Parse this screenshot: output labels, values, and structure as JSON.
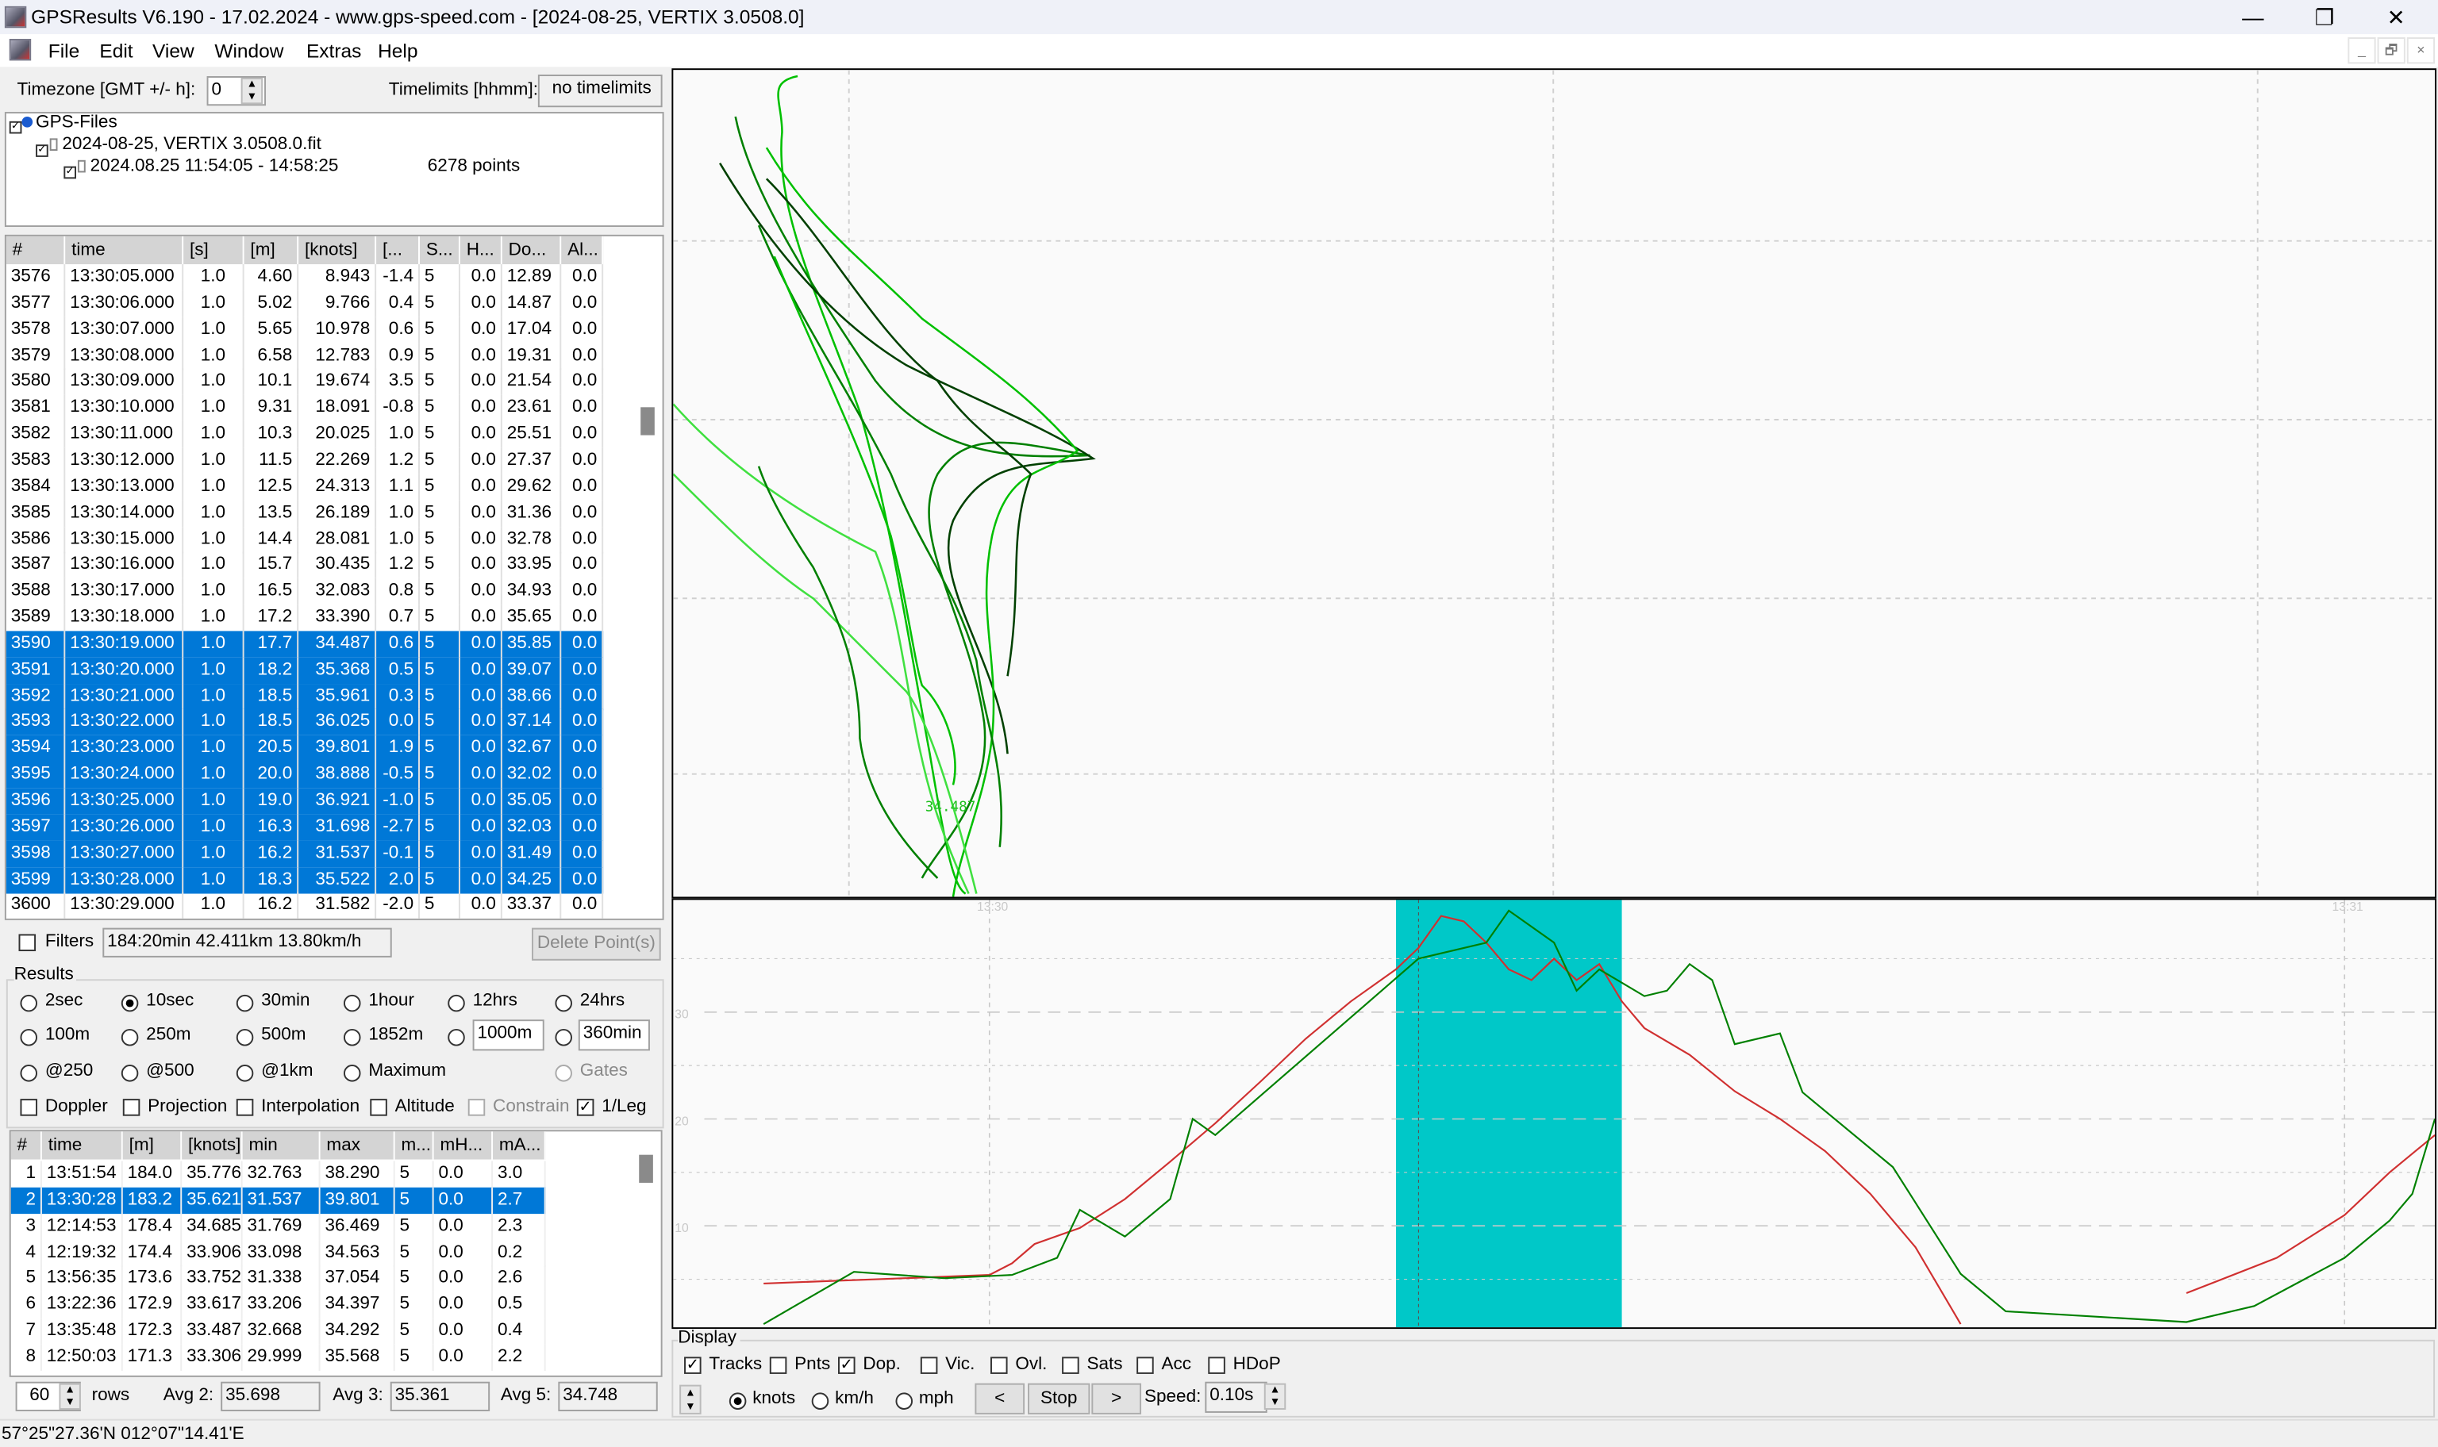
{
  "window": {
    "title": "GPSResults V6.190 - 17.02.2024 - www.gps-speed.com - [2024-08-25, VERTIX 3.0508.0]",
    "minimize": "—",
    "restore": "❐",
    "close": "✕"
  },
  "menu": [
    {
      "label": "File"
    },
    {
      "label": "Edit"
    },
    {
      "label": "View"
    },
    {
      "label": "Window"
    },
    {
      "label": "Extras"
    },
    {
      "label": "Help"
    }
  ],
  "mdi": {
    "min": "_",
    "restore": "🗗",
    "close": "×"
  },
  "timezone": {
    "label": "Timezone [GMT +/- h]:",
    "value": "0"
  },
  "timelimits": {
    "label": "Timelimits [hhmm]:",
    "value": "no timelimits"
  },
  "tree": {
    "root": "GPS-Files",
    "file": "2024-08-25, VERTIX 3.0508.0.fit",
    "track": "2024.08.25 11:54:05 - 14:58:25",
    "points": "6278 points"
  },
  "points_table": {
    "columns": [
      "#",
      "time",
      "[s]",
      "[m]",
      "[knots]",
      "[...",
      "S...",
      "H...",
      "Do...",
      "Al..."
    ],
    "rows": [
      [
        "3576",
        "13:30:05.000",
        "1.0",
        "4.60",
        "8.943",
        "-1.4",
        "5",
        "0.0",
        "12.89",
        "0.0"
      ],
      [
        "3577",
        "13:30:06.000",
        "1.0",
        "5.02",
        "9.766",
        "0.4",
        "5",
        "0.0",
        "14.87",
        "0.0"
      ],
      [
        "3578",
        "13:30:07.000",
        "1.0",
        "5.65",
        "10.978",
        "0.6",
        "5",
        "0.0",
        "17.04",
        "0.0"
      ],
      [
        "3579",
        "13:30:08.000",
        "1.0",
        "6.58",
        "12.783",
        "0.9",
        "5",
        "0.0",
        "19.31",
        "0.0"
      ],
      [
        "3580",
        "13:30:09.000",
        "1.0",
        "10.1",
        "19.674",
        "3.5",
        "5",
        "0.0",
        "21.54",
        "0.0"
      ],
      [
        "3581",
        "13:30:10.000",
        "1.0",
        "9.31",
        "18.091",
        "-0.8",
        "5",
        "0.0",
        "23.61",
        "0.0"
      ],
      [
        "3582",
        "13:30:11.000",
        "1.0",
        "10.3",
        "20.025",
        "1.0",
        "5",
        "0.0",
        "25.51",
        "0.0"
      ],
      [
        "3583",
        "13:30:12.000",
        "1.0",
        "11.5",
        "22.269",
        "1.2",
        "5",
        "0.0",
        "27.37",
        "0.0"
      ],
      [
        "3584",
        "13:30:13.000",
        "1.0",
        "12.5",
        "24.313",
        "1.1",
        "5",
        "0.0",
        "29.62",
        "0.0"
      ],
      [
        "3585",
        "13:30:14.000",
        "1.0",
        "13.5",
        "26.189",
        "1.0",
        "5",
        "0.0",
        "31.36",
        "0.0"
      ],
      [
        "3586",
        "13:30:15.000",
        "1.0",
        "14.4",
        "28.081",
        "1.0",
        "5",
        "0.0",
        "32.78",
        "0.0"
      ],
      [
        "3587",
        "13:30:16.000",
        "1.0",
        "15.7",
        "30.435",
        "1.2",
        "5",
        "0.0",
        "33.95",
        "0.0"
      ],
      [
        "3588",
        "13:30:17.000",
        "1.0",
        "16.5",
        "32.083",
        "0.8",
        "5",
        "0.0",
        "34.93",
        "0.0"
      ],
      [
        "3589",
        "13:30:18.000",
        "1.0",
        "17.2",
        "33.390",
        "0.7",
        "5",
        "0.0",
        "35.65",
        "0.0"
      ],
      [
        "3590",
        "13:30:19.000",
        "1.0",
        "17.7",
        "34.487",
        "0.6",
        "5",
        "0.0",
        "35.85",
        "0.0"
      ],
      [
        "3591",
        "13:30:20.000",
        "1.0",
        "18.2",
        "35.368",
        "0.5",
        "5",
        "0.0",
        "39.07",
        "0.0"
      ],
      [
        "3592",
        "13:30:21.000",
        "1.0",
        "18.5",
        "35.961",
        "0.3",
        "5",
        "0.0",
        "38.66",
        "0.0"
      ],
      [
        "3593",
        "13:30:22.000",
        "1.0",
        "18.5",
        "36.025",
        "0.0",
        "5",
        "0.0",
        "37.14",
        "0.0"
      ],
      [
        "3594",
        "13:30:23.000",
        "1.0",
        "20.5",
        "39.801",
        "1.9",
        "5",
        "0.0",
        "32.67",
        "0.0"
      ],
      [
        "3595",
        "13:30:24.000",
        "1.0",
        "20.0",
        "38.888",
        "-0.5",
        "5",
        "0.0",
        "32.02",
        "0.0"
      ],
      [
        "3596",
        "13:30:25.000",
        "1.0",
        "19.0",
        "36.921",
        "-1.0",
        "5",
        "0.0",
        "35.05",
        "0.0"
      ],
      [
        "3597",
        "13:30:26.000",
        "1.0",
        "16.3",
        "31.698",
        "-2.7",
        "5",
        "0.0",
        "32.03",
        "0.0"
      ],
      [
        "3598",
        "13:30:27.000",
        "1.0",
        "16.2",
        "31.537",
        "-0.1",
        "5",
        "0.0",
        "31.49",
        "0.0"
      ],
      [
        "3599",
        "13:30:28.000",
        "1.0",
        "18.3",
        "35.522",
        "2.0",
        "5",
        "0.0",
        "34.25",
        "0.0"
      ],
      [
        "3600",
        "13:30:29.000",
        "1.0",
        "16.2",
        "31.582",
        "-2.0",
        "5",
        "0.0",
        "33.37",
        "0.0"
      ]
    ],
    "selected_from": "3590",
    "selected_to": "3599"
  },
  "filters": {
    "label": "Filters",
    "checked": false,
    "summary": "184:20min 42.411km 13.80km/h",
    "delete": "Delete Point(s)"
  },
  "results": {
    "label": "Results",
    "radios": [
      [
        "2sec",
        "10sec",
        "30min",
        "1hour",
        "12hrs",
        "24hrs"
      ],
      [
        "100m",
        "250m",
        "500m",
        "1852m",
        "",
        ""
      ],
      [
        "@250",
        "@500",
        "@1km",
        "Maximum",
        "",
        "Gates"
      ]
    ],
    "selected": "10sec",
    "custom_distance": "1000m",
    "custom_time": "360min",
    "checks": [
      {
        "label": "Doppler",
        "checked": false
      },
      {
        "label": "Projection",
        "checked": false
      },
      {
        "label": "Interpolation",
        "checked": false
      },
      {
        "label": "Altitude",
        "checked": false
      },
      {
        "label": "Constrain",
        "checked": false,
        "disabled": true
      },
      {
        "label": "1/Leg",
        "checked": true
      }
    ]
  },
  "results_table": {
    "columns": [
      "#",
      "time",
      "[m]",
      "[knots]",
      "min",
      "max",
      "m...",
      "mH...",
      "mA..."
    ],
    "rows": [
      [
        "1",
        "13:51:54",
        "184.0",
        "35.776",
        "32.763",
        "38.290",
        "5",
        "0.0",
        "3.0"
      ],
      [
        "2",
        "13:30:28",
        "183.2",
        "35.621",
        "31.537",
        "39.801",
        "5",
        "0.0",
        "2.7"
      ],
      [
        "3",
        "12:14:53",
        "178.4",
        "34.685",
        "31.769",
        "36.469",
        "5",
        "0.0",
        "2.3"
      ],
      [
        "4",
        "12:19:32",
        "174.4",
        "33.906",
        "33.098",
        "34.563",
        "5",
        "0.0",
        "0.2"
      ],
      [
        "5",
        "13:56:35",
        "173.6",
        "33.752",
        "31.338",
        "37.054",
        "5",
        "0.0",
        "2.6"
      ],
      [
        "6",
        "13:22:36",
        "172.9",
        "33.617",
        "33.206",
        "34.397",
        "5",
        "0.0",
        "0.5"
      ],
      [
        "7",
        "13:35:48",
        "172.3",
        "33.487",
        "32.668",
        "34.292",
        "5",
        "0.0",
        "0.4"
      ],
      [
        "8",
        "12:50:03",
        "171.3",
        "33.306",
        "29.999",
        "35.568",
        "5",
        "0.0",
        "2.2"
      ]
    ],
    "selected_row": "2"
  },
  "footer": {
    "rows_value": "60",
    "rows_label": "rows",
    "avg2_label": "Avg 2:",
    "avg2": "35.698",
    "avg3_label": "Avg 3:",
    "avg3": "35.361",
    "avg5_label": "Avg 5:",
    "avg5": "34.748"
  },
  "status": {
    "coords": "57°25\"27.36'N 012°07\"14.41'E"
  },
  "map": {
    "label": "34.487",
    "track_colors": [
      "#00c000",
      "#008000",
      "#004000",
      "#40e040"
    ]
  },
  "display": {
    "label": "Display",
    "checks": [
      {
        "label": "Tracks",
        "checked": true
      },
      {
        "label": "Pnts",
        "checked": false
      },
      {
        "label": "Dop.",
        "checked": true
      },
      {
        "label": "Vic.",
        "checked": false
      },
      {
        "label": "Ovl.",
        "checked": false
      },
      {
        "label": "Sats",
        "checked": false
      },
      {
        "label": "Acc",
        "checked": false
      },
      {
        "label": "HDoP",
        "checked": false
      }
    ],
    "units": [
      "knots",
      "km/h",
      "mph"
    ],
    "unit_selected": "knots",
    "prev": "<",
    "stop": "Stop",
    "next": ">",
    "speed_label": "Speed:",
    "speed": "0.10s"
  },
  "chart_data": {
    "type": "line",
    "xlim": [
      "13:29:46",
      "13:31:04"
    ],
    "ylim": [
      0.5,
      40.5
    ],
    "x_ticks": [
      "13:30",
      "13:31"
    ],
    "y_ticks": [
      10,
      20,
      30
    ],
    "grid": true,
    "highlight": [
      "13:30:18",
      "13:30:28"
    ],
    "cursor": "13:30:19",
    "colors": {
      "highlight": "#00c8c8",
      "grid": "#c8c8c8",
      "tick": "#c8c8c8"
    },
    "series": [
      {
        "color": "#d03030",
        "points": [
          [
            "13:29:50",
            4.6
          ],
          [
            "13:29:55",
            5.0
          ],
          [
            "13:30:00",
            5.4
          ],
          [
            "13:30:01",
            6.5
          ],
          [
            "13:30:02",
            8.3
          ],
          [
            "13:30:04",
            9.8
          ],
          [
            "13:30:06",
            12.5
          ],
          [
            "13:30:08",
            16
          ],
          [
            "13:30:10",
            19.6
          ],
          [
            "13:30:12",
            23.5
          ],
          [
            "13:30:14",
            27.5
          ],
          [
            "13:30:16",
            31
          ],
          [
            "13:30:18",
            34
          ],
          [
            "13:30:19",
            36
          ],
          [
            "13:30:20",
            39
          ],
          [
            "13:30:21",
            38.5
          ],
          [
            "13:30:22",
            36.5
          ],
          [
            "13:30:23",
            34
          ],
          [
            "13:30:24",
            33
          ],
          [
            "13:30:25",
            35
          ],
          [
            "13:30:26",
            33
          ],
          [
            "13:30:27",
            34.5
          ],
          [
            "13:30:28",
            31
          ],
          [
            "13:30:29",
            28.5
          ],
          [
            "13:30:31",
            26
          ],
          [
            "13:30:33",
            22.6
          ],
          [
            "13:30:35",
            20
          ],
          [
            "13:30:37",
            17
          ],
          [
            "13:30:39",
            13
          ],
          [
            "13:30:41",
            8
          ],
          [
            "13:30:43",
            0.8
          ],
          null,
          [
            "13:30:53",
            3.7
          ],
          [
            "13:30:57",
            7
          ],
          [
            "13:31:00",
            11
          ],
          [
            "13:31:02",
            15
          ],
          [
            "13:31:04",
            18.5
          ]
        ]
      },
      {
        "color": "#008000",
        "points": [
          [
            "13:29:50",
            0.8
          ],
          [
            "13:29:54",
            5.7
          ],
          [
            "13:29:58",
            5.1
          ],
          [
            "13:30:01",
            5.4
          ],
          [
            "13:30:03",
            7.0
          ],
          [
            "13:30:04",
            11.5
          ],
          [
            "13:30:06",
            9.0
          ],
          [
            "13:30:08",
            12.5
          ],
          [
            "13:30:09",
            20
          ],
          [
            "13:30:10",
            18.5
          ],
          [
            "13:30:13",
            24
          ],
          [
            "13:30:16",
            29.5
          ],
          [
            "13:30:19",
            35
          ],
          [
            "13:30:22",
            36.5
          ],
          [
            "13:30:23",
            39.5
          ],
          [
            "13:30:25",
            36.5
          ],
          [
            "13:30:26",
            32
          ],
          [
            "13:30:27",
            34
          ],
          [
            "13:30:29",
            31.5
          ],
          [
            "13:30:30",
            32
          ],
          [
            "13:30:31",
            34.5
          ],
          [
            "13:30:32",
            33
          ],
          [
            "13:30:33",
            27
          ],
          [
            "13:30:35",
            28
          ],
          [
            "13:30:36",
            22.5
          ],
          [
            "13:30:40",
            15.5
          ],
          [
            "13:30:43",
            5.5
          ],
          [
            "13:30:45",
            2
          ],
          [
            "13:30:53",
            1
          ],
          [
            "13:30:56",
            2.5
          ],
          [
            "13:31:00",
            7
          ],
          [
            "13:31:02",
            10.5
          ],
          [
            "13:31:03",
            13
          ],
          [
            "13:31:04",
            20
          ]
        ]
      }
    ]
  }
}
